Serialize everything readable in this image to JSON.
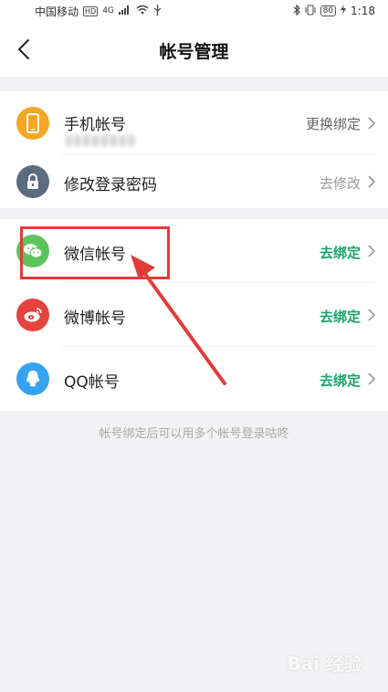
{
  "status_bar": {
    "carrier": "中国移动",
    "hd_badge": "HD",
    "signal_text": "4G",
    "battery": "80",
    "time": "1:18"
  },
  "header": {
    "title": "帐号管理"
  },
  "sections": {
    "account": {
      "phone": {
        "label": "手机帐号",
        "action": "更换绑定",
        "icon": "phone-icon"
      },
      "password": {
        "label": "修改登录密码",
        "action": "去修改",
        "icon": "lock-icon"
      }
    },
    "social": {
      "wechat": {
        "label": "微信帐号",
        "action": "去绑定",
        "icon": "wechat-icon"
      },
      "weibo": {
        "label": "微博帐号",
        "action": "去绑定",
        "icon": "weibo-icon"
      },
      "qq": {
        "label": "QQ帐号",
        "action": "去绑定",
        "icon": "qq-icon"
      }
    }
  },
  "hint": "帐号绑定后可以用多个帐号登录咕咚",
  "watermark": "Bai 经验",
  "colors": {
    "accent_green": "#1aa36b",
    "phone_icon_bg": "#f5a623",
    "lock_icon_bg": "#5b6b80",
    "wechat_icon_bg": "#5cc45a",
    "weibo_icon_bg": "#e6423e",
    "qq_icon_bg": "#35a3f0",
    "annotation_red": "#e23b3b"
  }
}
